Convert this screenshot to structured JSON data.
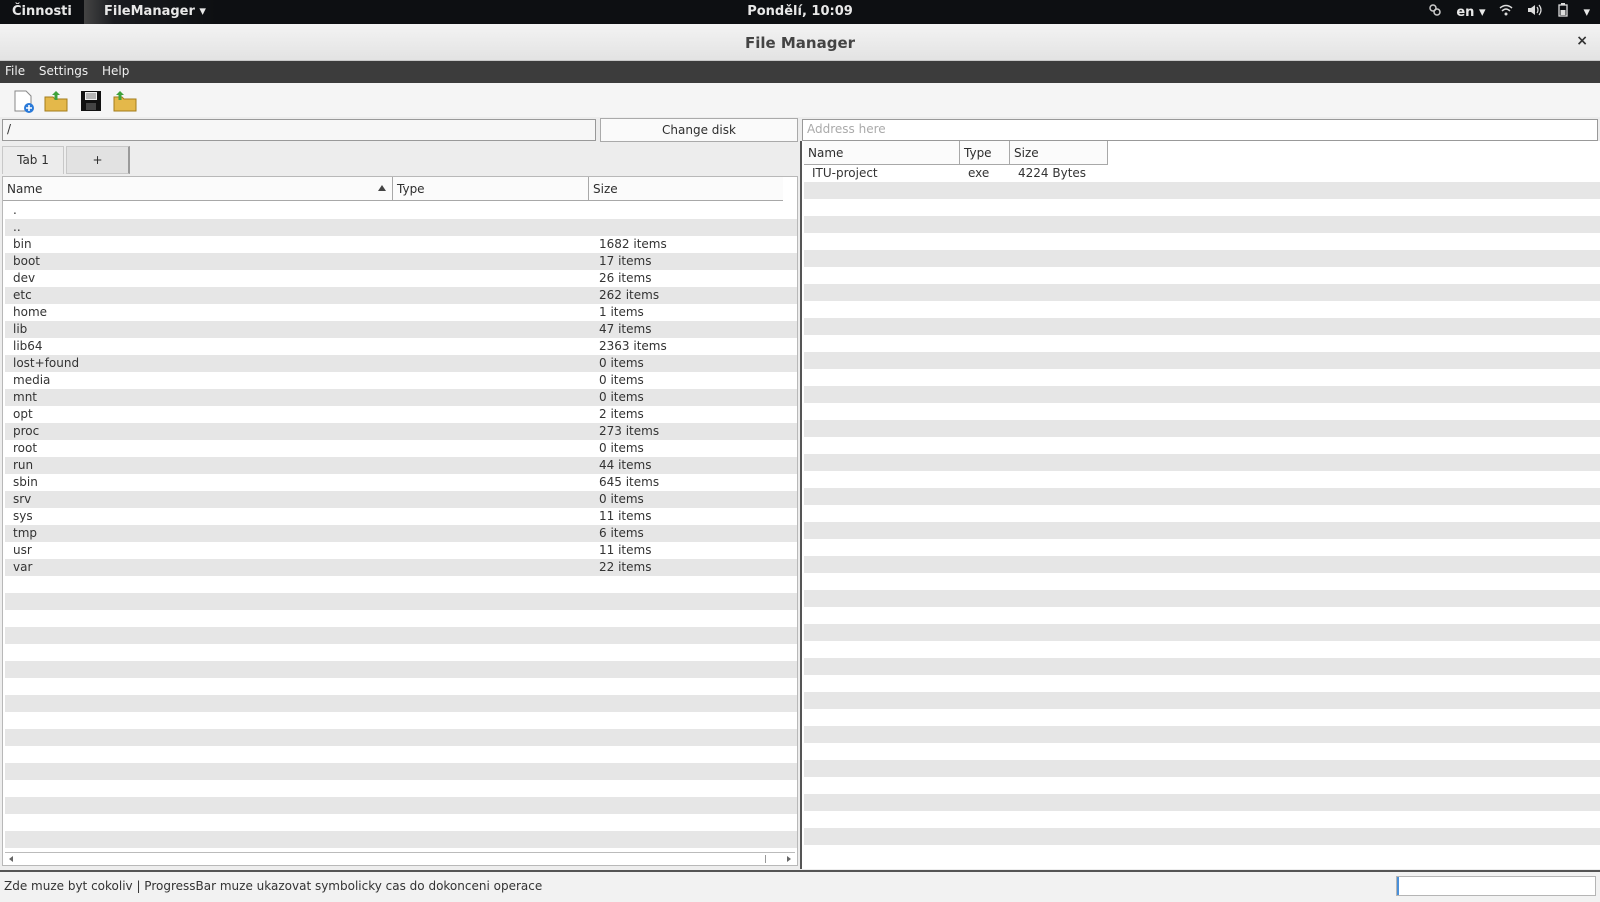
{
  "topbar": {
    "activities": "Činnosti",
    "app_menu": "FileManager ▾",
    "clock": "Pondělí, 10:09",
    "lang": "en ▾",
    "power_caret": "▾"
  },
  "window": {
    "title": "File Manager",
    "close": "×"
  },
  "menu": {
    "file": "File",
    "settings": "Settings",
    "help": "Help"
  },
  "toolbar": {
    "icons": [
      "new-file-icon",
      "open-folder-icon",
      "save-icon",
      "upload-folder-icon"
    ]
  },
  "left": {
    "path": "/",
    "change_disk": "Change disk",
    "tabs": [
      "Tab 1",
      "+"
    ],
    "columns": {
      "name": "Name",
      "type": "Type",
      "size": "Size"
    },
    "rows": [
      {
        "name": ".",
        "type": "",
        "size": ""
      },
      {
        "name": "..",
        "type": "",
        "size": ""
      },
      {
        "name": "bin",
        "type": "",
        "size": "1682 items"
      },
      {
        "name": "boot",
        "type": "",
        "size": "17 items"
      },
      {
        "name": "dev",
        "type": "",
        "size": "26 items"
      },
      {
        "name": "etc",
        "type": "",
        "size": "262 items"
      },
      {
        "name": "home",
        "type": "",
        "size": "1 items"
      },
      {
        "name": "lib",
        "type": "",
        "size": "47 items"
      },
      {
        "name": "lib64",
        "type": "",
        "size": "2363 items"
      },
      {
        "name": "lost+found",
        "type": "",
        "size": "0 items"
      },
      {
        "name": "media",
        "type": "",
        "size": "0 items"
      },
      {
        "name": "mnt",
        "type": "",
        "size": "0 items"
      },
      {
        "name": "opt",
        "type": "",
        "size": "2 items"
      },
      {
        "name": "proc",
        "type": "",
        "size": "273 items"
      },
      {
        "name": "root",
        "type": "",
        "size": "0 items"
      },
      {
        "name": "run",
        "type": "",
        "size": "44 items"
      },
      {
        "name": "sbin",
        "type": "",
        "size": "645 items"
      },
      {
        "name": "srv",
        "type": "",
        "size": "0 items"
      },
      {
        "name": "sys",
        "type": "",
        "size": "11 items"
      },
      {
        "name": "tmp",
        "type": "",
        "size": "6 items"
      },
      {
        "name": "usr",
        "type": "",
        "size": "11 items"
      },
      {
        "name": "var",
        "type": "",
        "size": "22 items"
      }
    ]
  },
  "right": {
    "address_placeholder": "Address here",
    "columns": {
      "name": "Name",
      "type": "Type",
      "size": "Size"
    },
    "rows": [
      {
        "name": "ITU-project",
        "type": "exe",
        "size": "4224 Bytes"
      }
    ]
  },
  "status": {
    "message": "Zde muze byt cokoliv | ProgressBar muze ukazovat symbolicky cas do dokonceni operace",
    "progress": 0.01
  }
}
